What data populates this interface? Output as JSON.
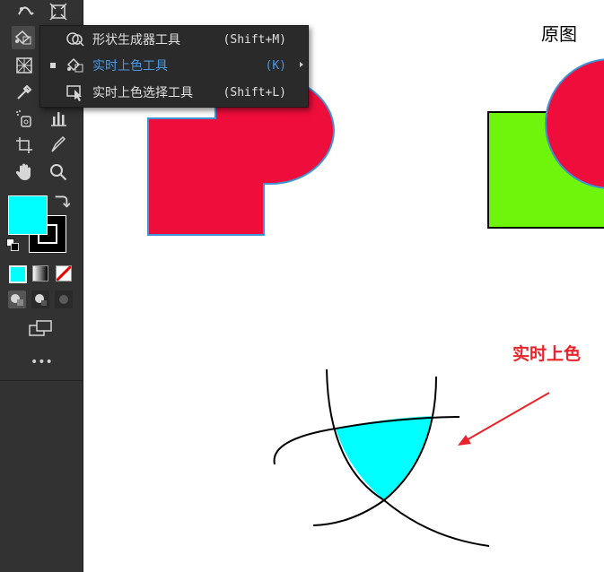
{
  "toolbar": {
    "tools": [
      {
        "name": "width-tool-icon"
      },
      {
        "name": "free-transform-icon"
      },
      {
        "name": "live-paint-bucket-icon"
      },
      {
        "name": "perspective-grid-icon"
      },
      {
        "name": "mesh-tool-icon"
      },
      {
        "name": "eyedropper-icon"
      },
      {
        "name": "symbol-sprayer-icon"
      },
      {
        "name": "column-graph-icon"
      },
      {
        "name": "artboard-tool-icon"
      },
      {
        "name": "slice-tool-icon"
      },
      {
        "name": "hand-tool-icon"
      },
      {
        "name": "zoom-tool-icon"
      }
    ],
    "fill_color": "#00ffff",
    "stroke_color": "#000000",
    "more_label": "•••"
  },
  "flyout": {
    "items": [
      {
        "label": "形状生成器工具",
        "shortcut": "(Shift+M)",
        "selected": false
      },
      {
        "label": "实时上色工具",
        "shortcut": "(K)",
        "selected": true
      },
      {
        "label": "实时上色选择工具",
        "shortcut": "(Shift+L)",
        "selected": false
      }
    ]
  },
  "canvas": {
    "original_label": "原图",
    "live_paint_label": "实时上色",
    "colors": {
      "red": "#ef0d3b",
      "green": "#6ef50b",
      "cyan": "#00ffff",
      "outline_blue": "#3e95d5",
      "arrow_red": "#e8232a"
    }
  }
}
